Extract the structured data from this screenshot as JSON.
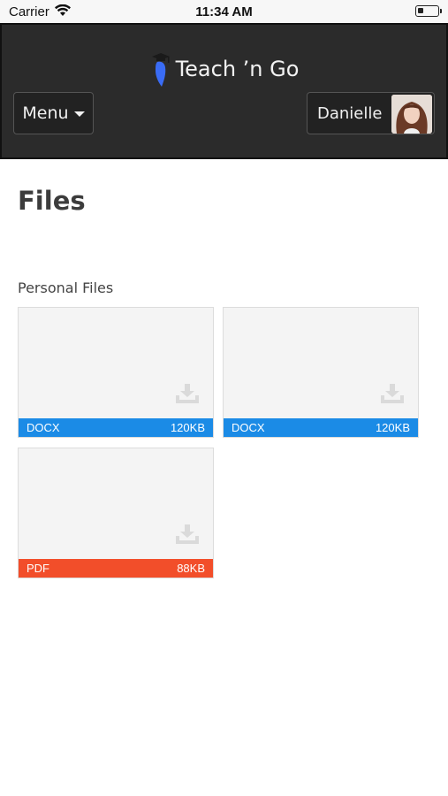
{
  "status_bar": {
    "carrier": "Carrier",
    "time": "11:34 AM"
  },
  "header": {
    "brand": "Teach ’n Go",
    "menu_label": "Menu",
    "user_name": "Danielle"
  },
  "page": {
    "title": "Files",
    "section_title": "Personal Files"
  },
  "files": [
    {
      "type": "DOCX",
      "size": "120KB",
      "color": "#1b8be6"
    },
    {
      "type": "DOCX",
      "size": "120KB",
      "color": "#1b8be6"
    },
    {
      "type": "PDF",
      "size": "88KB",
      "color": "#f24e2a"
    }
  ],
  "icons": [
    "wifi-icon",
    "battery-icon",
    "brand-logo-icon",
    "caret-down-icon",
    "avatar",
    "download-icon"
  ]
}
